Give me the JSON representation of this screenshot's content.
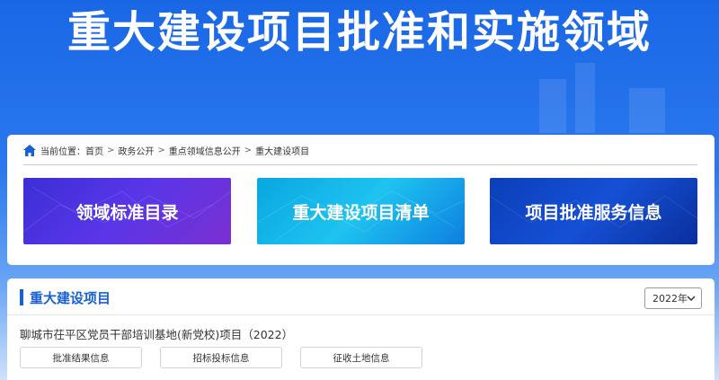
{
  "banner": {
    "title": "重大建设项目批准和实施领域"
  },
  "breadcrumb": {
    "label": "当前位置：",
    "items": [
      "首页",
      "政务公开",
      "重点领域信息公开",
      "重大建设项目"
    ],
    "separator": ">",
    "icon": "home-icon"
  },
  "tiles": [
    {
      "label": "领域标准目录"
    },
    {
      "label": "重大建设项目清单"
    },
    {
      "label": "项目批准服务信息"
    }
  ],
  "section": {
    "title": "重大建设项目",
    "year_selected": "2022年"
  },
  "project": {
    "title": "聊城市茌平区党员干部培训基地(新党校)项目（2022）",
    "buttons": [
      "批准结果信息",
      "招标投标信息",
      "征收土地信息"
    ]
  },
  "colors": {
    "accent": "#1760d6",
    "banner": "#1a67e6"
  }
}
